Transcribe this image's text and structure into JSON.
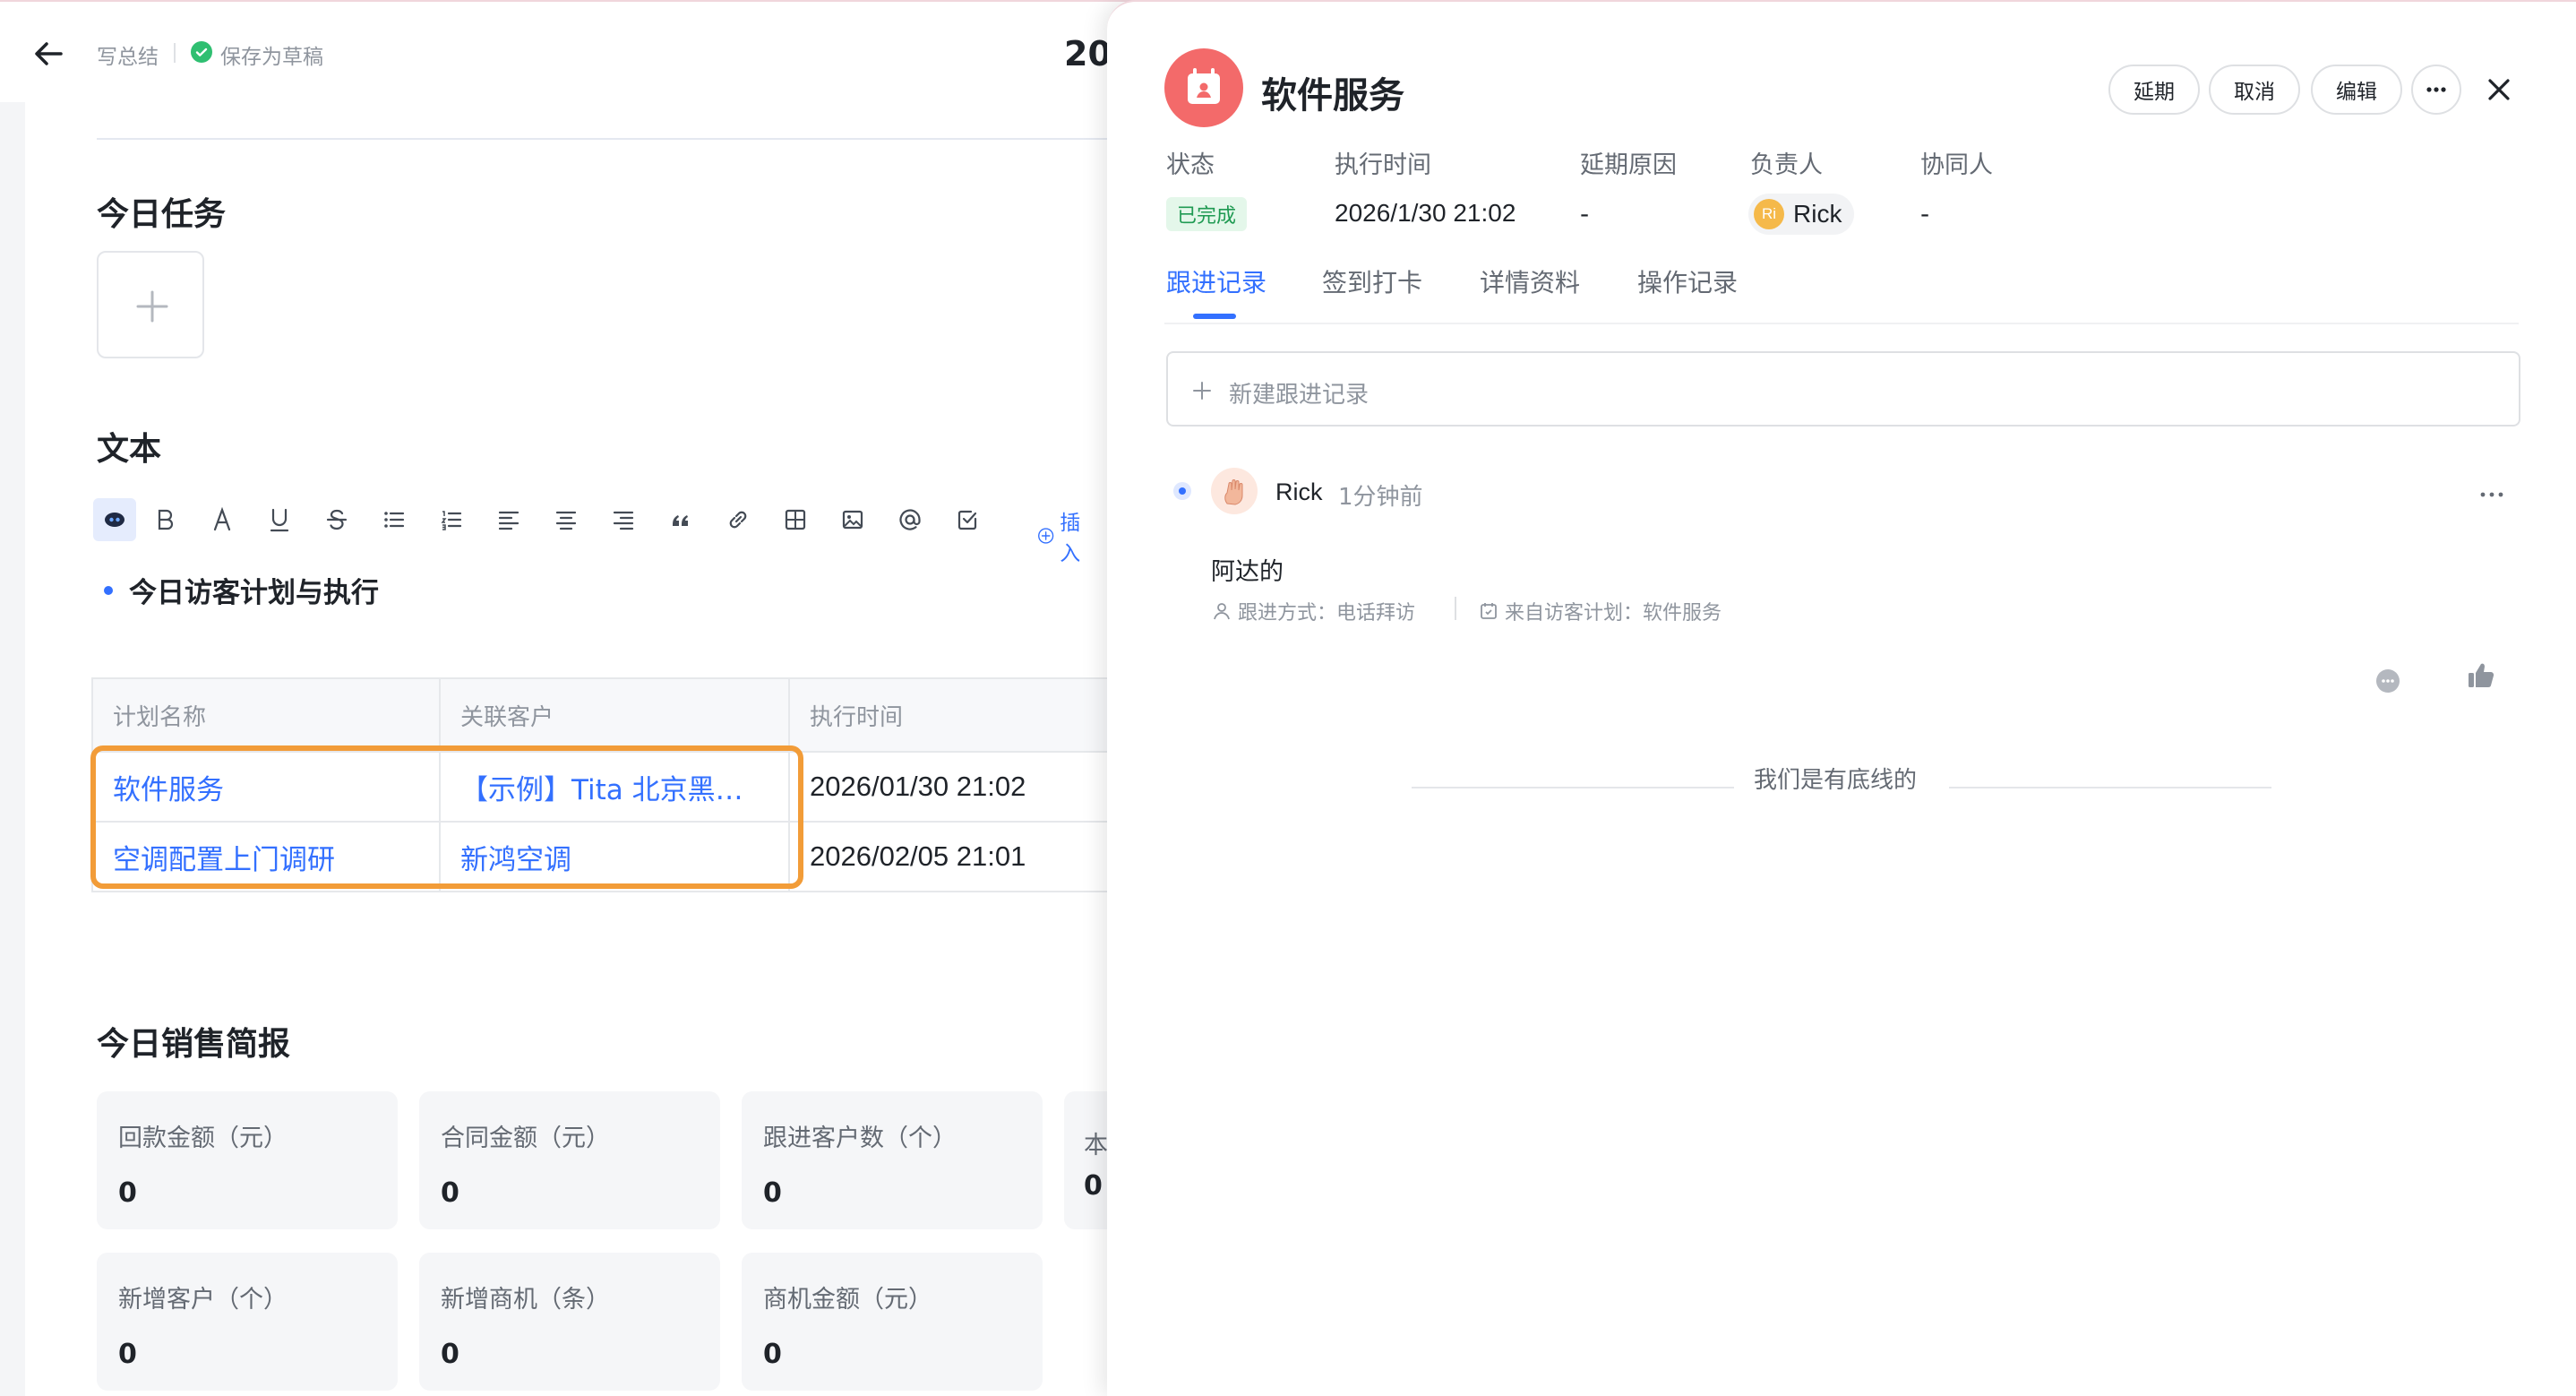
{
  "topbar": {
    "write_summary": "写总结",
    "saved_status": "保存为草稿",
    "doc_title_partial": "20"
  },
  "doc": {
    "section_today_tasks": "今日任务",
    "section_text": "文本",
    "toolbar": {
      "insert_label": "插入"
    },
    "bullet_heading": "今日访客计划与执行",
    "table": {
      "columns": [
        "计划名称",
        "关联客户",
        "执行时间"
      ],
      "rows": [
        {
          "plan": "软件服务",
          "customer": "【示例】Tita 北京黑…",
          "time": "2026/01/30 21:02"
        },
        {
          "plan": "空调配置上门调研",
          "customer": "新鸿空调",
          "time": "2026/02/05 21:01"
        }
      ]
    },
    "section_sales": "今日销售简报",
    "cards": [
      {
        "label": "回款金额（元）",
        "value": "0"
      },
      {
        "label": "合同金额（元）",
        "value": "0"
      },
      {
        "label": "跟进客户数（个）",
        "value": "0"
      },
      {
        "label": "本",
        "value": "0"
      },
      {
        "label": "新增客户（个）",
        "value": "0"
      },
      {
        "label": "新增商机（条）",
        "value": "0"
      },
      {
        "label": "商机金额（元）",
        "value": "0"
      }
    ]
  },
  "panel": {
    "title": "软件服务",
    "buttons": {
      "postpone": "延期",
      "cancel": "取消",
      "edit": "编辑"
    },
    "meta": {
      "status_label": "状态",
      "status_value": "已完成",
      "exec_time_label": "执行时间",
      "exec_time_value": "2026/1/30 21:02",
      "delay_reason_label": "延期原因",
      "delay_reason_value": "-",
      "owner_label": "负责人",
      "owner_initials": "Ri",
      "owner_name": "Rick",
      "collaborator_label": "协同人",
      "collaborator_value": "-"
    },
    "tabs": [
      "跟进记录",
      "签到打卡",
      "详情资料",
      "操作记录"
    ],
    "new_record_placeholder": "新建跟进记录",
    "record": {
      "author": "Rick",
      "time": "1分钟前",
      "content": "阿达的",
      "method": "跟进方式：电话拜访",
      "source": "来自访客计划：软件服务"
    },
    "end_text": "我们是有底线的"
  },
  "colors": {
    "accent": "#3370ff",
    "highlight_border": "#f29c38",
    "status_green": "#1f9a52",
    "logo_red": "#f36a6a"
  }
}
